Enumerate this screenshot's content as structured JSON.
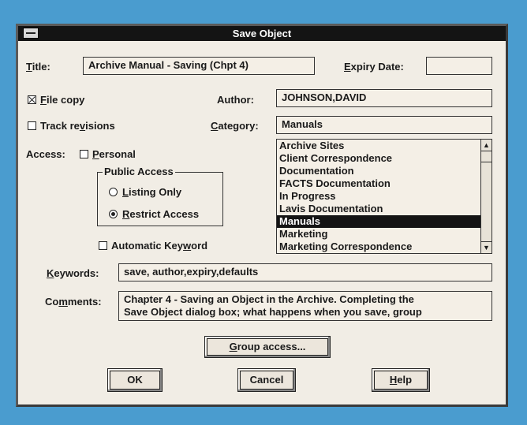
{
  "dialog": {
    "title": "Save Object"
  },
  "title_field": {
    "label": "Title:",
    "value": "Archive Manual - Saving (Chpt 4)"
  },
  "expiry": {
    "label": "Expiry Date:",
    "value": ""
  },
  "file_copy": {
    "label": "File copy",
    "checked": true
  },
  "track_revisions": {
    "label": "Track revisions",
    "checked": false
  },
  "author": {
    "label": "Author:",
    "value": "JOHNSON,DAVID"
  },
  "category": {
    "label": "Category:",
    "value": "Manuals"
  },
  "access": {
    "label": "Access:",
    "personal_label": "Personal",
    "personal_checked": false
  },
  "public_access": {
    "title": "Public Access",
    "listing_only": "Listing Only",
    "restrict_access": "Restrict Access",
    "selected": "restrict_access"
  },
  "automatic_keyword": {
    "label": "Automatic  Keyword",
    "checked": false
  },
  "category_list": {
    "items": [
      "Archive Sites",
      "Client Correspondence",
      "Documentation",
      "FACTS Documentation",
      "In Progress",
      "Lavis Documentation",
      "Manuals",
      "Marketing",
      "Marketing Correspondence"
    ],
    "selected": "Manuals"
  },
  "keywords": {
    "label": "Keywords:",
    "value": "save, author,expiry,defaults"
  },
  "comments": {
    "label": "Comments:",
    "line1": "Chapter 4 - Saving an Object in the Archive. Completing the",
    "line2": "Save Object dialog box; what happens when you save, group"
  },
  "buttons": {
    "group_access": "Group access...",
    "ok": "OK",
    "cancel": "Cancel",
    "help": "Help"
  }
}
